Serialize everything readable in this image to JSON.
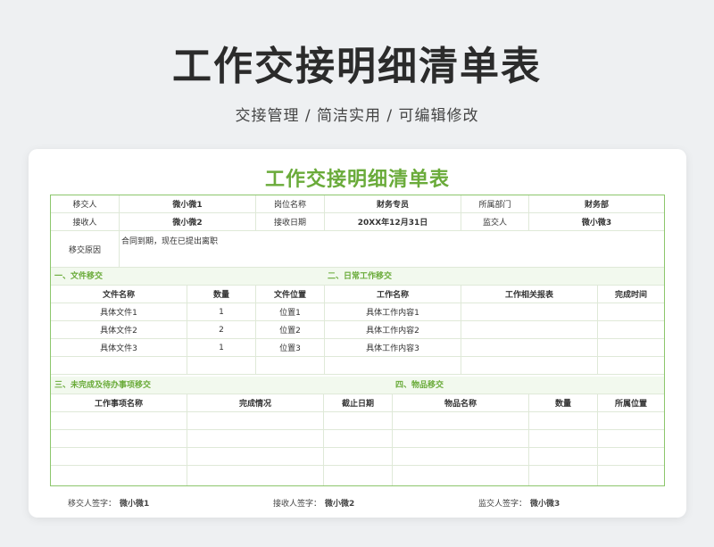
{
  "hero": {
    "title": "工作交接明细清单表",
    "subtitle": "交接管理 / 简洁实用 / 可编辑修改"
  },
  "sheet": {
    "title": "工作交接明细清单表",
    "info_rows": [
      [
        "移交人",
        "微小微1",
        "岗位名称",
        "财务专员",
        "所属部门",
        "财务部"
      ],
      [
        "接收人",
        "微小微2",
        "接收日期",
        "20XX年12月31日",
        "监交人",
        "微小微3"
      ]
    ],
    "reason_label": "移交原因",
    "reason_text": "合同到期，现在已提出离职",
    "section1": "一、文件移交",
    "section2": "二、日常工作移交",
    "section3": "三、未完成及待办事项移交",
    "section4": "四、物品移交",
    "files_headers": [
      "文件名称",
      "数量",
      "文件位置"
    ],
    "work_headers": [
      "工作名称",
      "工作相关报表",
      "完成时间"
    ],
    "files_rows": [
      [
        "具体文件1",
        "1",
        "位置1"
      ],
      [
        "具体文件2",
        "2",
        "位置2"
      ],
      [
        "具体文件3",
        "1",
        "位置3"
      ],
      [
        "",
        "",
        ""
      ]
    ],
    "work_rows": [
      [
        "具体工作内容1",
        "",
        ""
      ],
      [
        "具体工作内容2",
        "",
        ""
      ],
      [
        "具体工作内容3",
        "",
        ""
      ],
      [
        "",
        "",
        ""
      ]
    ],
    "todo_headers": [
      "工作事项名称",
      "完成情况",
      "截止日期"
    ],
    "item_headers": [
      "物品名称",
      "数量",
      "所属位置"
    ],
    "bottom_rows": 4,
    "footer": {
      "handover_label": "移交人签字：",
      "handover_value": "微小微1",
      "receiver_label": "接收人签字：",
      "receiver_value": "微小微2",
      "supervisor_label": "监交人签字：",
      "supervisor_value": "微小微3"
    }
  },
  "colors": {
    "accent": "#6aab3a",
    "border": "#8cc66c",
    "section_bg": "#f2f9ee"
  }
}
